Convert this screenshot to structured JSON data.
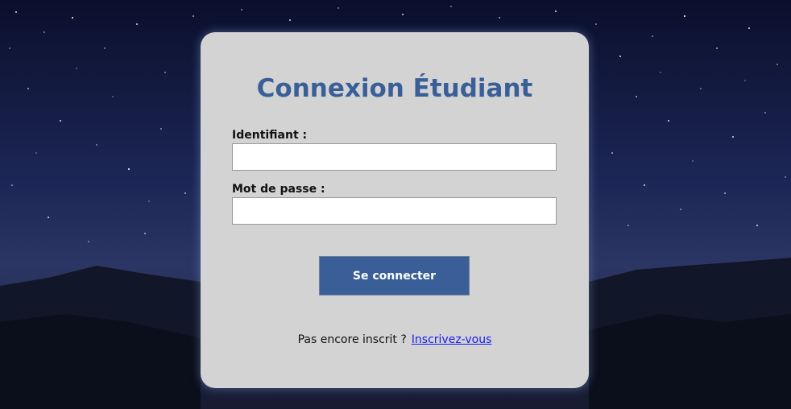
{
  "login": {
    "title": "Connexion Étudiant",
    "username_label": "Identifiant :",
    "username_value": "",
    "password_label": "Mot de passe :",
    "password_value": "",
    "submit_label": "Se connecter",
    "signup_prompt": "Pas encore inscrit ?",
    "signup_link": "Inscrivez-vous"
  },
  "colors": {
    "accent": "#3a5f98",
    "card_background": "#d3d3d3",
    "link": "#1a1aee"
  }
}
